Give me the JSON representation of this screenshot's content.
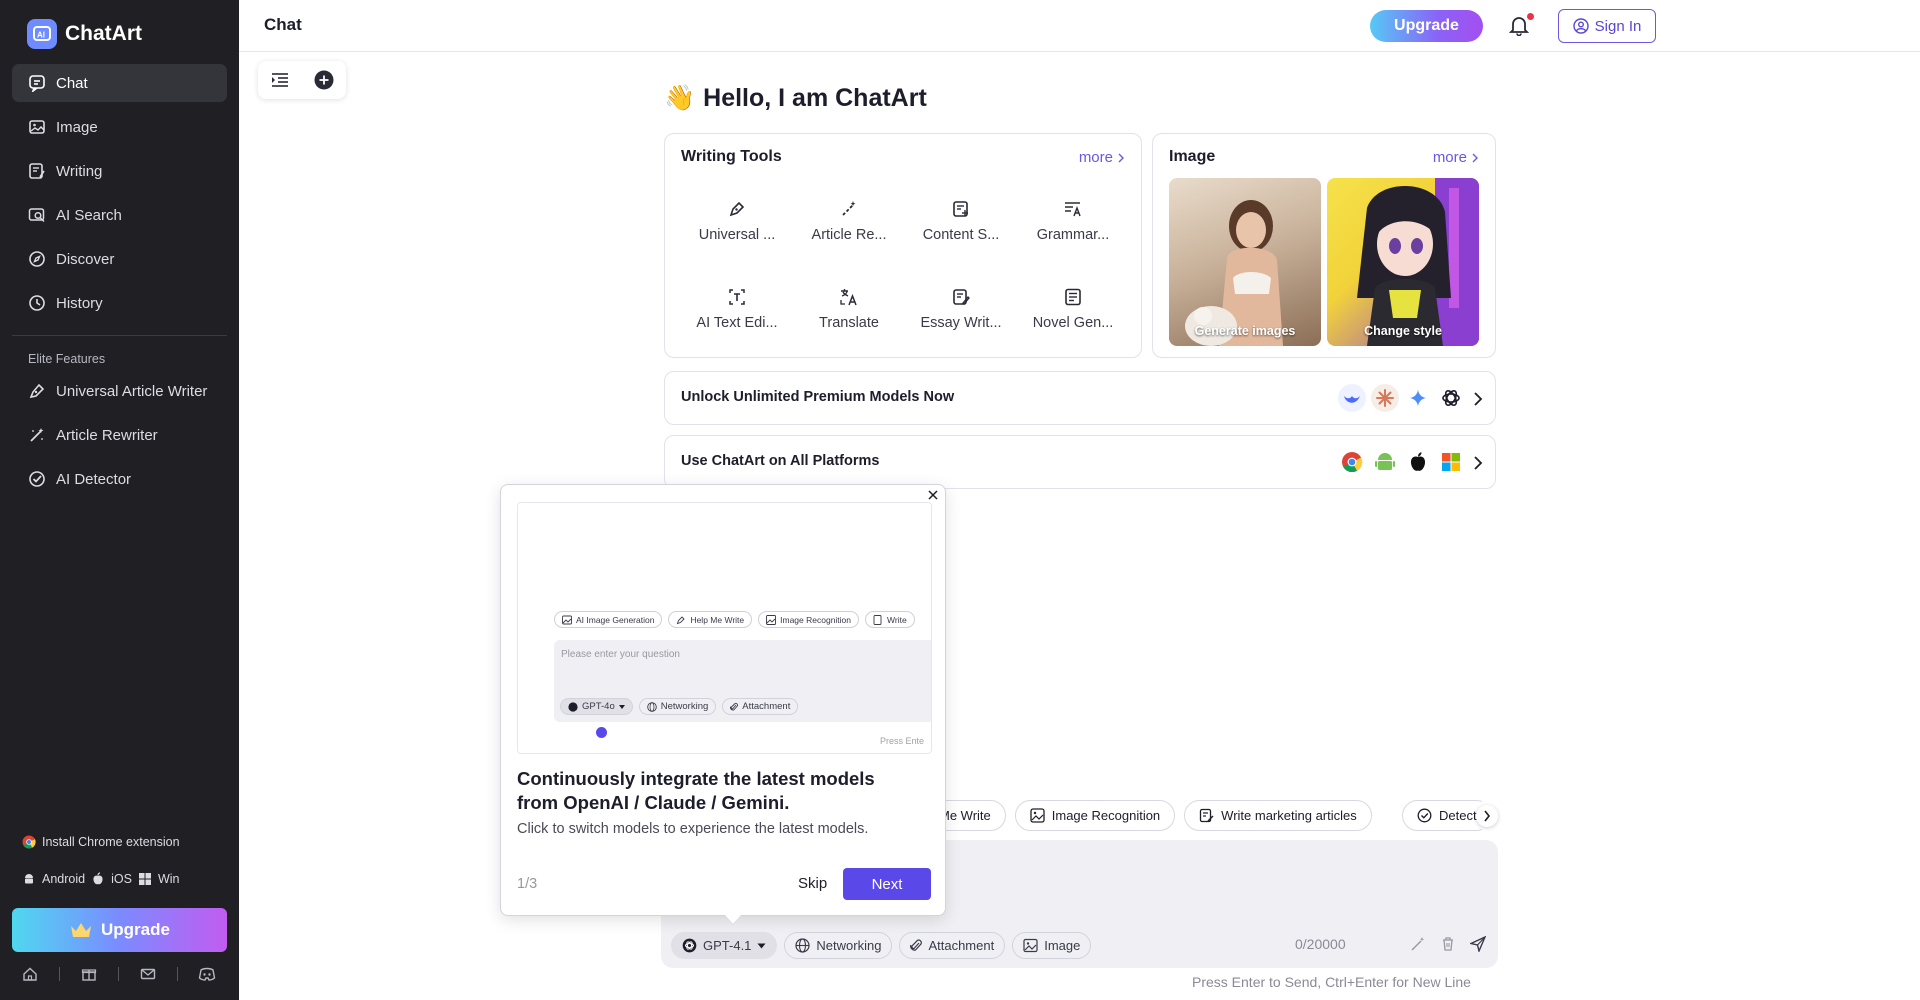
{
  "app": {
    "name": "ChatArt"
  },
  "sidebar": {
    "nav": [
      {
        "label": "Chat",
        "icon": "chat-icon"
      },
      {
        "label": "Image",
        "icon": "image-icon"
      },
      {
        "label": "Writing",
        "icon": "writing-icon"
      },
      {
        "label": "AI Search",
        "icon": "search-icon"
      },
      {
        "label": "Discover",
        "icon": "compass-icon"
      },
      {
        "label": "History",
        "icon": "history-icon"
      }
    ],
    "section_title": "Elite Features",
    "elite": [
      {
        "label": "Universal Article Writer",
        "icon": "pen-icon"
      },
      {
        "label": "Article Rewriter",
        "icon": "magic-wand-icon"
      },
      {
        "label": "AI Detector",
        "icon": "check-circle-icon"
      }
    ],
    "chrome_ext": "Install Chrome extension",
    "platforms": [
      "Android",
      "iOS",
      "Win"
    ],
    "upgrade": "Upgrade"
  },
  "topbar": {
    "title": "Chat",
    "upgrade": "Upgrade",
    "signin": "Sign In"
  },
  "main": {
    "greeting": "Hello, I am ChatArt",
    "greeting_emoji": "👋",
    "writing_tools": {
      "title": "Writing Tools",
      "more": "more",
      "items": [
        "Universal ...",
        "Article Re...",
        "Content S...",
        "Grammar...",
        "AI Text Edi...",
        "Translate",
        "Essay Writ...",
        "Novel Gen..."
      ]
    },
    "image_card": {
      "title": "Image",
      "more": "more",
      "tiles": [
        "Generate images",
        "Change style"
      ]
    },
    "premium_row": "Unlock Unlimited Premium Models Now",
    "platforms_row": "Use ChatArt on All Platforms"
  },
  "chips": [
    "Me Write",
    "Image Recognition",
    "Write marketing articles",
    "Detect"
  ],
  "input": {
    "model": "GPT-4.1",
    "networking": "Networking",
    "attachment": "Attachment",
    "image": "Image",
    "counter": "0/20000",
    "hint": "Press Enter to Send, Ctrl+Enter for New Line"
  },
  "popup": {
    "preview": {
      "chips": [
        "AI Image Generation",
        "Help Me Write",
        "Image Recognition",
        "Write"
      ],
      "placeholder": "Please enter your question",
      "model": "GPT-4o",
      "networking": "Networking",
      "attachment": "Attachment",
      "hint": "Press Ente"
    },
    "title": "Continuously integrate the latest models from OpenAI / Claude / Gemini.",
    "description": "Click to switch models to experience the latest models.",
    "step": "1/3",
    "skip": "Skip",
    "next": "Next"
  },
  "colors": {
    "accent": "#5b48e8",
    "sidebar_bg": "#1f1f24",
    "brand_blue": "#6e8cff"
  }
}
